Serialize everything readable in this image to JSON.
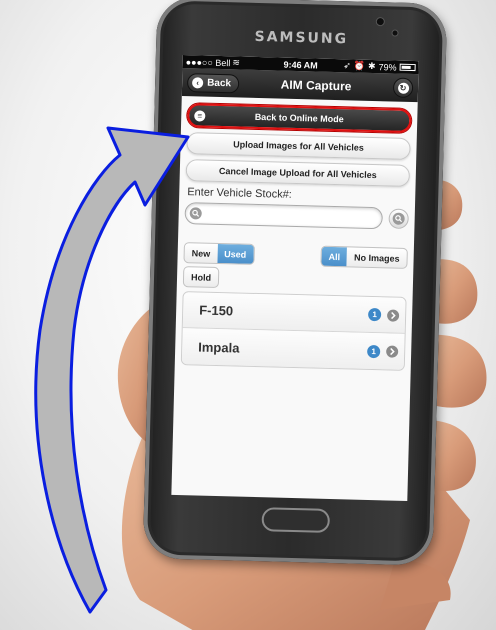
{
  "device": {
    "brand": "SAMSUNG"
  },
  "status_bar": {
    "carrier": "●●●○○ Bell",
    "time": "9:46 AM",
    "battery": "79%",
    "battery_level": 0.79
  },
  "header": {
    "back_label": "Back",
    "title": "AIM Capture"
  },
  "actions": {
    "online_mode": "Back to Online Mode",
    "upload_all": "Upload Images for All Vehicles",
    "cancel_upload": "Cancel Image Upload for All Vehicles"
  },
  "search": {
    "label": "Enter Vehicle Stock#:",
    "placeholder": ""
  },
  "filters": {
    "condition": [
      {
        "label": "New",
        "active": false
      },
      {
        "label": "Used",
        "active": true
      }
    ],
    "images": [
      {
        "label": "All",
        "active": true
      },
      {
        "label": "No Images",
        "active": false
      }
    ],
    "hold_label": "Hold"
  },
  "vehicles": [
    {
      "name": "F-150",
      "count": "1"
    },
    {
      "name": "Impala",
      "count": "1"
    }
  ],
  "colors": {
    "accent": "#4a8fca",
    "highlight": "#e01111",
    "arrow_fill": "#b8b8b8",
    "arrow_stroke": "#0a1ee0"
  }
}
